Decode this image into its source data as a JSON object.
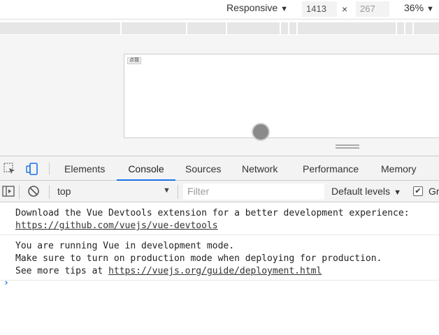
{
  "device_toolbar": {
    "mode": "Responsive",
    "width": "1413",
    "times": "×",
    "height": "267",
    "zoom": "36%"
  },
  "emulated_page": {
    "button_label": "点我"
  },
  "tabs": [
    "Elements",
    "Console",
    "Sources",
    "Network",
    "Performance",
    "Memory"
  ],
  "active_tab": "Console",
  "console_toolbar": {
    "context": "top",
    "filter_placeholder": "Filter",
    "levels": "Default levels",
    "group_label": "Gr"
  },
  "messages": {
    "m1_line1": "Download the Vue Devtools extension for a better development experience:",
    "m1_link": "https://github.com/vuejs/vue-devtools",
    "m2_line1": "You are running Vue in development mode.",
    "m2_line2": "Make sure to turn on production mode when deploying for production.",
    "m2_line3_prefix": "See more tips at ",
    "m2_link": "https://vuejs.org/guide/deployment.html"
  },
  "prompt_symbol": "›",
  "colors": {
    "accent": "#1a73e8",
    "toolbar_bg": "#f3f3f3",
    "viewport_bg": "#f5f5f5"
  }
}
